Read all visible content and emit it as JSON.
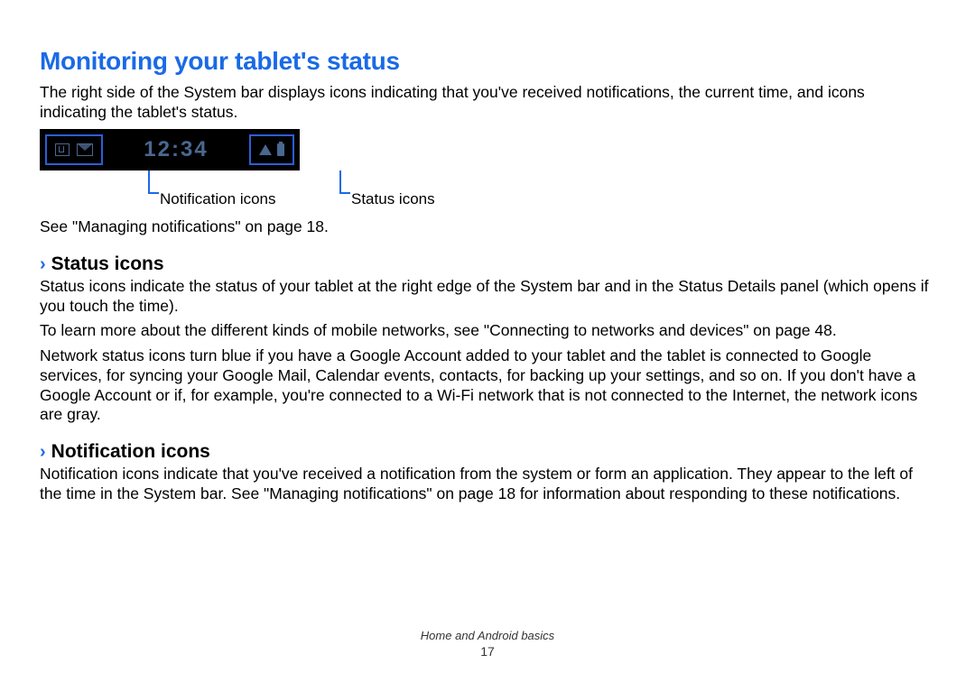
{
  "heading": "Monitoring your tablet's status",
  "intro": "The right side of the System bar displays icons indicating that you've received notifications, the current time, and icons indicating the tablet's status.",
  "figure": {
    "clock": "12:34",
    "callout_notification": "Notification icons",
    "callout_status": "Status icons"
  },
  "see_ref": "See \"Managing notifications\" on page 18.",
  "sections": {
    "status": {
      "title": "Status icons",
      "p1": "Status icons indicate the status of your tablet at the right edge of the System bar and in the Status Details panel (which opens if you touch the time).",
      "p2": "To learn more about the different kinds of mobile networks, see \"Connecting to networks and devices\" on page 48.",
      "p3": "Network status icons turn blue if you have a Google Account added to your tablet and the tablet is connected to Google services, for syncing your Google Mail, Calendar events, contacts, for backing up your settings, and so on. If you don't have a Google Account or if, for example, you're connected to a Wi-Fi network that is not connected to the Internet, the network icons are gray."
    },
    "notification": {
      "title": "Notification icons",
      "p1": "Notification icons indicate that you've received a notification from the system or form an application. They appear to the left of the time in the System bar. See \"Managing notifications\" on page 18 for information about responding to these notifications."
    }
  },
  "footer": {
    "chapter": "Home and Android basics",
    "page": "17"
  }
}
